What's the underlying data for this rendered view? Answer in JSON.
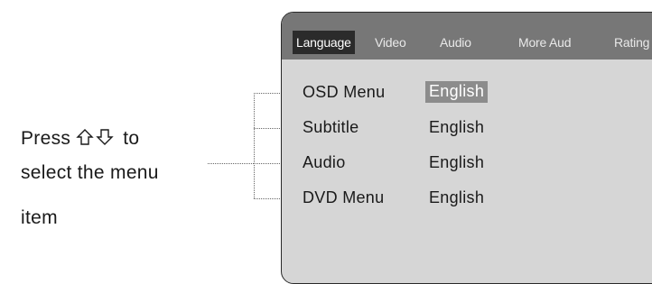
{
  "instruction": {
    "line1_prefix": "Press",
    "arrow_icons": [
      "up-arrow-icon",
      "down-arrow-icon"
    ],
    "line1_suffix": "to",
    "line2": "select the menu",
    "line3": "item"
  },
  "osd": {
    "tabs": [
      "Language",
      "Video",
      "Audio",
      "More Aud",
      "Rating"
    ],
    "active_tab": "Language",
    "items": [
      {
        "label": "OSD Menu",
        "value": "English",
        "selected": true
      },
      {
        "label": "Subtitle",
        "value": "English",
        "selected": false
      },
      {
        "label": "Audio",
        "value": "English",
        "selected": false
      },
      {
        "label": "DVD Menu",
        "value": "English",
        "selected": false
      }
    ]
  },
  "colors": {
    "tab_bar": "#777777",
    "active_tab": "#2b2b2b",
    "panel_bg": "#d6d6d6",
    "selected_value_bg": "#8c8c8c"
  }
}
